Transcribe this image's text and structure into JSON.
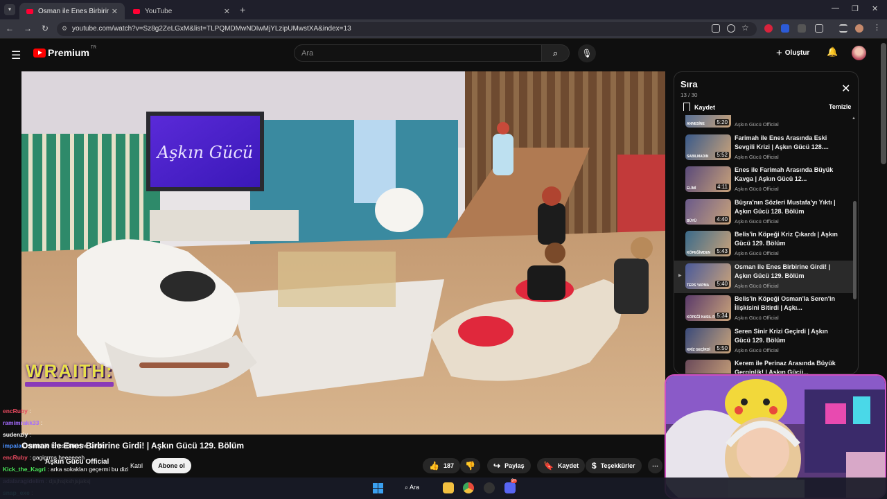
{
  "browser": {
    "tabs": [
      {
        "title": "Osman ile Enes Birbirine Girdi! |",
        "active": true
      },
      {
        "title": "YouTube",
        "active": false
      }
    ],
    "url": "youtube.com/watch?v=Sz8g2ZeLGxM&list=TLPQMDMwNDIwMjYLzipUMwstXA&index=13"
  },
  "header": {
    "logo": "Premium",
    "region": "TR",
    "search_placeholder": "Ara",
    "create_label": "Oluştur"
  },
  "queue": {
    "title": "Sıra",
    "position": "13 / 30",
    "save_label": "Kaydet",
    "clear_label": "Temizle",
    "items": [
      {
        "title": "",
        "channel": "Aşkın Gücü Official",
        "duration": "5:20",
        "thumb_text": "ANNESİNE",
        "active": false
      },
      {
        "title": "Farimah ile Enes Arasında Eski Sevgili Krizi | Aşkın Gücü 128....",
        "channel": "Aşkın Gücü Official",
        "duration": "5:52",
        "thumb_text": "SABILMADIN",
        "active": false
      },
      {
        "title": "Enes ile Farimah Arasında Büyük Kavga | Aşkın Gücü 12...",
        "channel": "Aşkın Gücü Official",
        "duration": "4:11",
        "thumb_text": "ELİMİ",
        "active": false
      },
      {
        "title": "Büşra'nın Sözleri Mustafa'yı Yıktı | Aşkın Gücü 128. Bölüm",
        "channel": "Aşkın Gücü Official",
        "duration": "4:40",
        "thumb_text": "BÜYÜ",
        "active": false
      },
      {
        "title": "Belis'in Köpeği Kriz Çıkardı | Aşkın Gücü 129. Bölüm",
        "channel": "Aşkın Gücü Official",
        "duration": "5:43",
        "thumb_text": "KÖPEĞİMDEN",
        "active": false
      },
      {
        "title": "Osman ile Enes Birbirine Girdi! | Aşkın Gücü 129. Bölüm",
        "channel": "Aşkın Gücü Official",
        "duration": "5:40",
        "thumb_text": "TERS YAPMA",
        "active": true
      },
      {
        "title": "Belis'in Köpeği Osman'la Seren'in İlişkisini Bitirdi | Aşkı...",
        "channel": "Aşkın Gücü Official",
        "duration": "5:34",
        "thumb_text": "KÖPEĞİ NASIL PAYLAŞ",
        "active": false
      },
      {
        "title": "Seren Sinir Krizi Geçirdi | Aşkın Gücü 129. Bölüm",
        "channel": "Aşkın Gücü Official",
        "duration": "5:50",
        "thumb_text": "KRİZ GEÇİRDİ",
        "active": false
      },
      {
        "title": "Kerem ile Perinaz Arasında Büyük Gerginlik! | Aşkın Gücü...",
        "channel": "",
        "duration": "",
        "thumb_text": "",
        "active": false
      }
    ]
  },
  "video": {
    "title": "Osman ile Enes Birbirine Girdi! | Aşkın Gücü 129. Bölüm",
    "channel": "Aşkın Gücü Official",
    "join_label": "Katıl",
    "subscribe_label": "Abone ol",
    "likes": "187",
    "share_label": "Paylaş",
    "save_label": "Kaydet",
    "thanks_label": "Teşekkürler",
    "screen_logo": "Aşkın Gücü"
  },
  "overlay": {
    "badge": "WRAITH:",
    "chat": [
      {
        "user": "encRuby",
        "msg": ":",
        "color": "#e84a5f"
      },
      {
        "user": "ramimrakk33",
        "msg": ":",
        "color": "#a56bff"
      },
      {
        "user": "sudenziy",
        "msg": ":",
        "color": "#ffffff"
      },
      {
        "user": "impala",
        "msg": "Osman ile Enes Birbirine Girdi!",
        "color": "#4a90ff"
      },
      {
        "user": "encRuby",
        "msg": ": gagigrms heeeeeeh",
        "color": "#e84a5f"
      },
      {
        "user": "Kick_the_Kagri",
        "msg": ": arka sokakları geçermi bu dizi",
        "color": "#4ae85a"
      },
      {
        "user": "adalaragidelim",
        "msg": ": djsjhsjkshjsjaksj",
        "color": "#c8b4ff"
      },
      {
        "user": "snap_exe",
        "msg": ":",
        "color": "#4ae8e0"
      }
    ]
  },
  "taskbar": {
    "search_label": "Ara",
    "discord_badge": "9+"
  },
  "colors": {
    "yt_red": "#ff0000",
    "bg": "#0f0f0f",
    "cam_border": "#d04fc0"
  }
}
